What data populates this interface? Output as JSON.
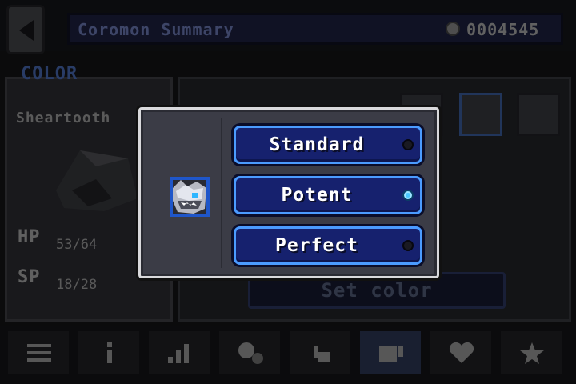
{
  "header": {
    "title": "Coromon Summary",
    "coins": "0004545",
    "coin_icon": "coin-icon",
    "back_icon": "back-arrow-icon"
  },
  "summary": {
    "section_label": "COLOR",
    "coromon_name": "Sheartooth",
    "stats": [
      {
        "label": "HP",
        "value": "53/64"
      },
      {
        "label": "SP",
        "value": "18/28"
      }
    ],
    "set_color_label": "Set color"
  },
  "tabs": [
    {
      "icon": "list-icon"
    },
    {
      "icon": "info-icon"
    },
    {
      "icon": "stats-icon"
    },
    {
      "icon": "skills-icon"
    },
    {
      "icon": "hand-icon"
    },
    {
      "icon": "color-icon",
      "active": true
    },
    {
      "icon": "heart-icon"
    },
    {
      "icon": "star-icon"
    }
  ],
  "modal": {
    "icon": "coromon-portrait-icon",
    "options": [
      {
        "label": "Standard",
        "selected": false
      },
      {
        "label": "Potent",
        "selected": true
      },
      {
        "label": "Perfect",
        "selected": false
      }
    ]
  },
  "colors": {
    "button_fill": "#16216e",
    "button_border": "#4b9bff",
    "selected_dot": "#49c8ff",
    "modal_bg": "#3b3c46"
  }
}
